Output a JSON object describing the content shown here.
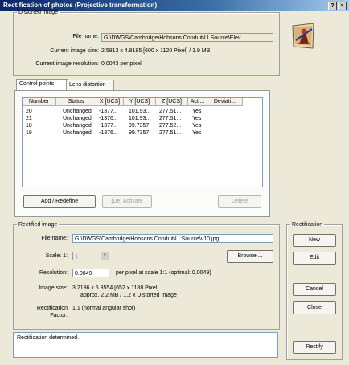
{
  "window": {
    "title": "Rectification of photos (Projective transformation)",
    "help_btn": "?",
    "close_btn": "×"
  },
  "distorted": {
    "legend": "Distorted image",
    "file_name_label": "File name:",
    "file_name_value": "G:\\DWGS\\Cambridge\\Hobsons Conduit\\LI Source\\Elev",
    "size_label": "Current image size:",
    "size_value": "2.5813 x 4.8185 [600 x 1120 Pixel] / 1.9 MB",
    "resolution_label": "Current image resolution:",
    "resolution_value": "0.0043 per pixel"
  },
  "tabs": {
    "control_points": "Control points",
    "lens_distortion": "Lens distortion"
  },
  "control_points": {
    "columns": [
      "Number",
      "Status",
      "X [UCS]",
      "Y [UCS]",
      "Z [UCS]",
      "Acti...",
      "Deviati..."
    ],
    "rows": [
      [
        "20",
        "Unchanged",
        "-1377...",
        "101.93...",
        "277.51...",
        "Yes",
        ""
      ],
      [
        "21",
        "Unchanged",
        "-1376...",
        "101.93...",
        "277.51...",
        "Yes",
        ""
      ],
      [
        "18",
        "Unchanged",
        "-1377...",
        "99.7357",
        "277.52...",
        "Yes",
        ""
      ],
      [
        "19",
        "Unchanged",
        "-1376...",
        "99.7357",
        "277.51...",
        "Yes",
        ""
      ]
    ],
    "add_btn": "Add / Redefine",
    "activate_btn": "[De] Activate",
    "delete_btn": "Delete"
  },
  "rectified": {
    "legend": "Rectified image",
    "file_name_label": "File name:",
    "file_name_value": "G:\\DWGS\\Cambridge\\Hobsons Conduit\\LI Source\\v10.jpg",
    "scale_label": "Scale: 1:",
    "scale_value": "1",
    "browse_btn": "Browse ...",
    "resolution_label": "Resolution:",
    "resolution_value": "0.0049",
    "resolution_note": "per pixel at scale 1:1 (optimal: 0.0049)",
    "size_label": "Image size:",
    "size_line1": "3.2136 x 5.8554 [652 x 1188 Pixel]",
    "size_line2": "approx. 2.2 MB  / 1.2 x Distorted Image",
    "factor_label_1": "Rectification",
    "factor_label_2": "Factor:",
    "factor_value": "1.1  (normal angular shot)"
  },
  "rectification_panel": {
    "legend": "Rectification",
    "new_btn": "New",
    "edit_btn": "Edit",
    "cancel_btn": "Cancel",
    "close_btn": "Close",
    "rectify_btn": "Rectify"
  },
  "status": {
    "text": "Rectification determined."
  },
  "icons": {
    "photo": "photo-rectification-icon",
    "dropdown": "chevron-down-icon"
  }
}
